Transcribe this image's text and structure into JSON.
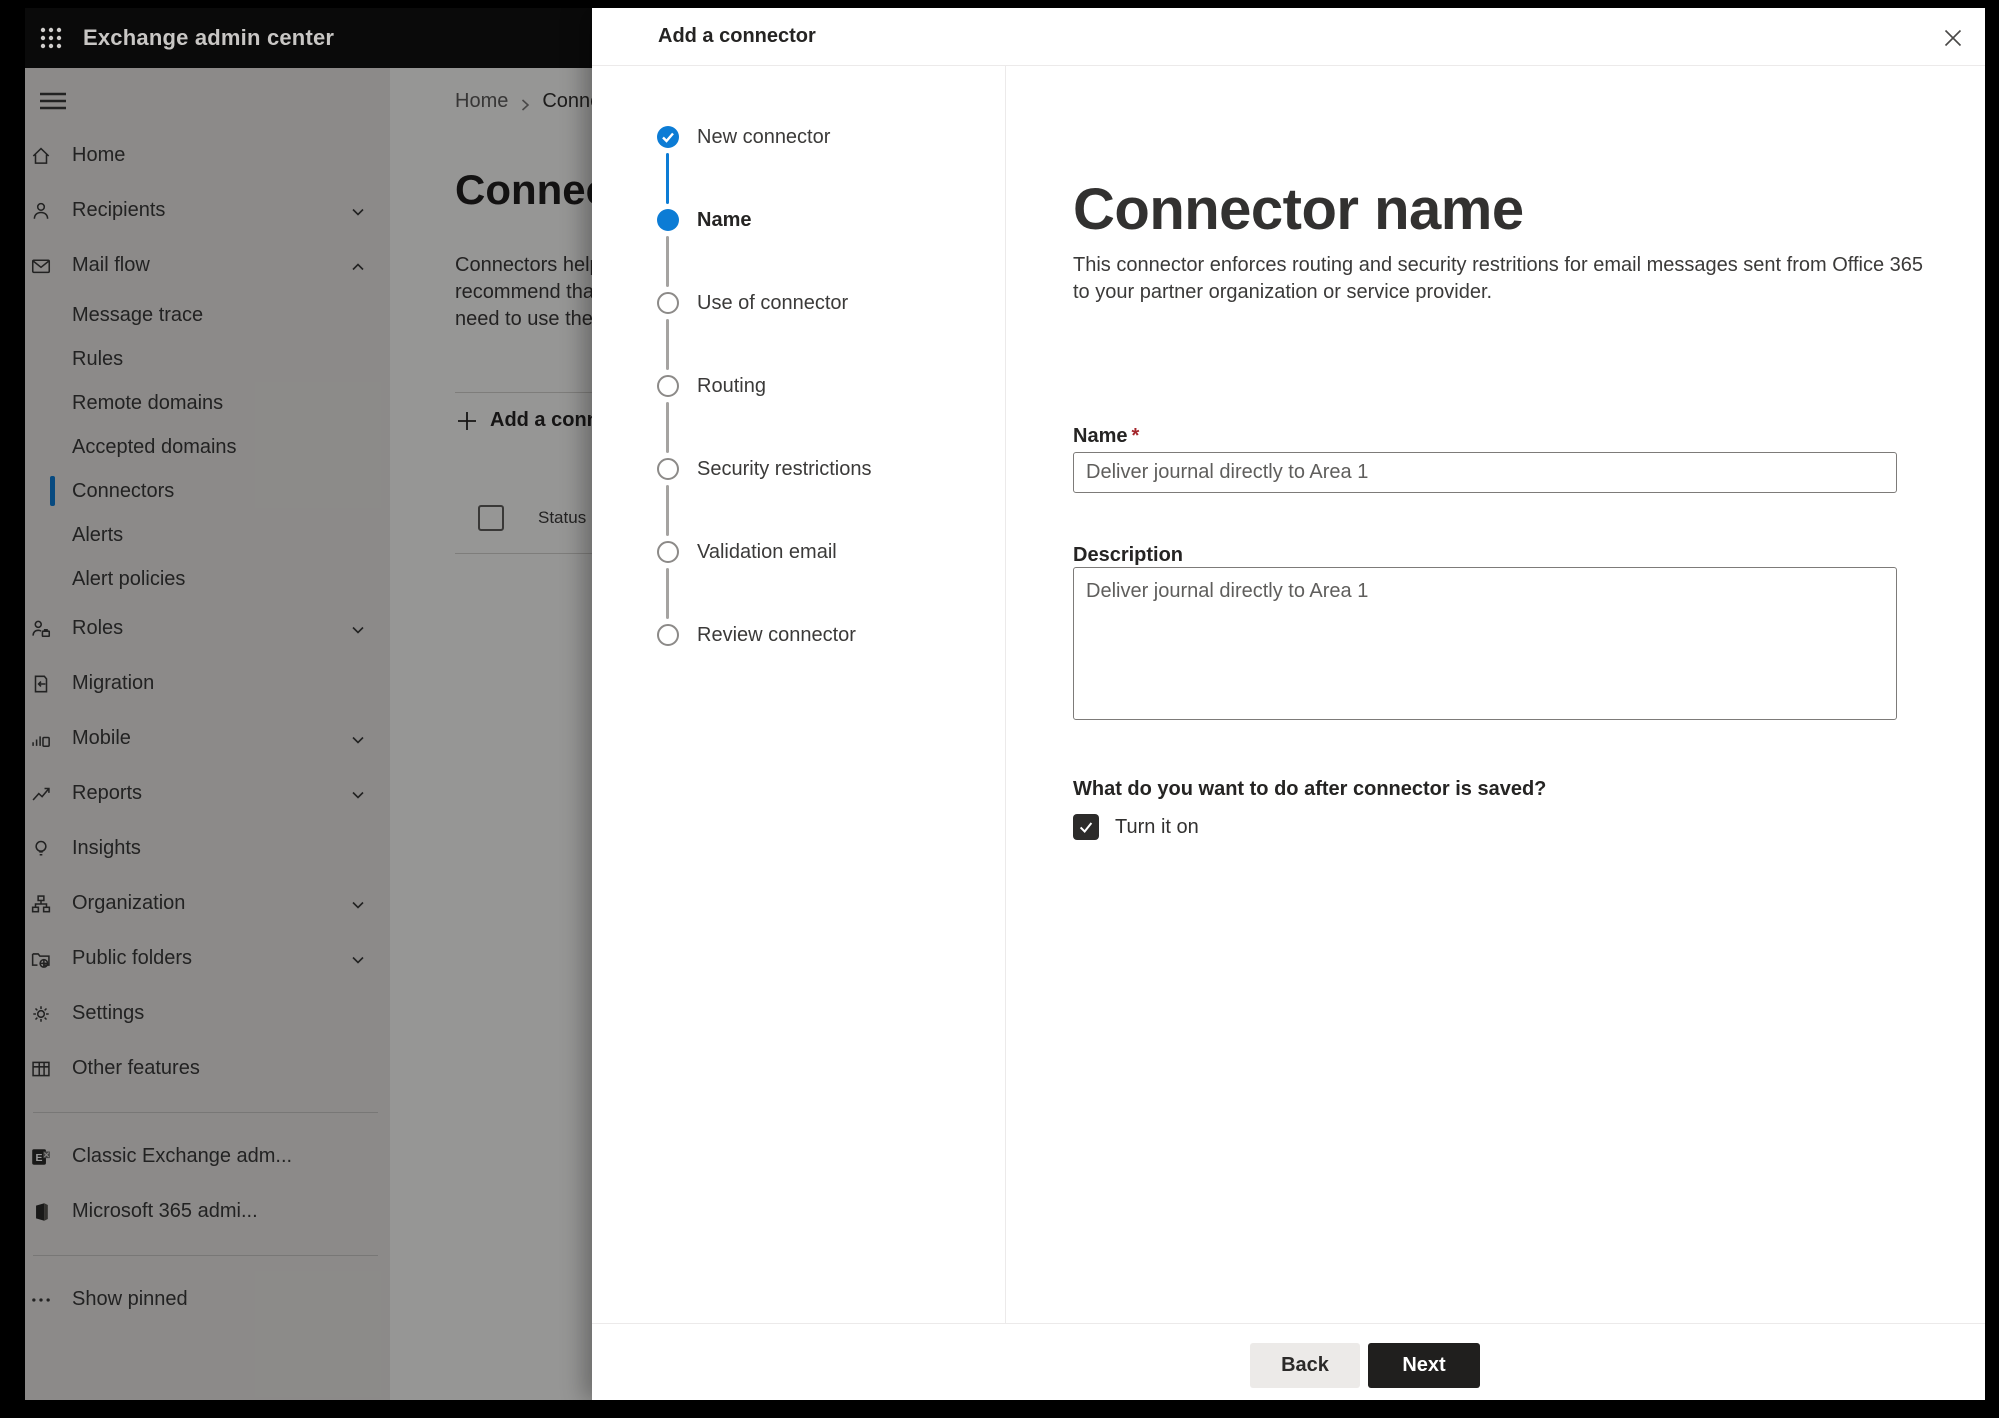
{
  "colors": {
    "accent": "#0c7cd5",
    "dark_button": "#201f1e",
    "required": "#a4262c"
  },
  "appbar": {
    "title": "Exchange admin center"
  },
  "sidebar": {
    "items": [
      {
        "label": "Home",
        "icon": "home"
      },
      {
        "label": "Recipients",
        "icon": "person",
        "chevron": "down"
      },
      {
        "label": "Mail flow",
        "icon": "mail",
        "chevron": "up"
      },
      {
        "label": "Message trace",
        "sub": true
      },
      {
        "label": "Rules",
        "sub": true
      },
      {
        "label": "Remote domains",
        "sub": true
      },
      {
        "label": "Accepted domains",
        "sub": true
      },
      {
        "label": "Connectors",
        "sub": true,
        "selected": true
      },
      {
        "label": "Alerts",
        "sub": true
      },
      {
        "label": "Alert policies",
        "sub": true
      },
      {
        "label": "Roles",
        "icon": "roles",
        "chevron": "down"
      },
      {
        "label": "Migration",
        "icon": "migration"
      },
      {
        "label": "Mobile",
        "icon": "mobile",
        "chevron": "down"
      },
      {
        "label": "Reports",
        "icon": "reports",
        "chevron": "down"
      },
      {
        "label": "Insights",
        "icon": "insights"
      },
      {
        "label": "Organization",
        "icon": "organization",
        "chevron": "down"
      },
      {
        "label": "Public folders",
        "icon": "folders",
        "chevron": "down"
      },
      {
        "label": "Settings",
        "icon": "settings"
      },
      {
        "label": "Other features",
        "icon": "grid"
      },
      {
        "divider": true
      },
      {
        "label": "Classic Exchange adm...",
        "icon": "exchange"
      },
      {
        "label": "Microsoft 365 admi...",
        "icon": "m365"
      },
      {
        "divider": true
      },
      {
        "label": "Show pinned",
        "icon": "ellipsis"
      }
    ]
  },
  "page": {
    "breadcrumb": {
      "home": "Home",
      "current": "Connectors"
    },
    "title": "Connectors",
    "intro_lines": [
      "Connectors help",
      "recommend that",
      "need to use ther"
    ],
    "add_button": "Add a connector",
    "table": {
      "status_header": "Status"
    }
  },
  "dialog": {
    "title": "Add a connector",
    "steps": [
      {
        "label": "New connector",
        "state": "done"
      },
      {
        "label": "Name",
        "state": "current"
      },
      {
        "label": "Use of connector",
        "state": "todo"
      },
      {
        "label": "Routing",
        "state": "todo"
      },
      {
        "label": "Security restrictions",
        "state": "todo"
      },
      {
        "label": "Validation email",
        "state": "todo"
      },
      {
        "label": "Review connector",
        "state": "todo"
      }
    ],
    "heading": "Connector name",
    "description_lines": [
      "This connector enforces routing and security restritions for email messages sent from Office 365",
      "to your partner organization or service provider."
    ],
    "name_field": {
      "label": "Name",
      "required_mark": "*",
      "value": "Deliver journal directly to Area 1"
    },
    "description_field": {
      "label": "Description",
      "value": "Deliver journal directly to Area 1"
    },
    "after_save": {
      "question": "What do you want to do after connector is saved?",
      "checkbox_label": "Turn it on",
      "checked": true
    },
    "footer": {
      "back": "Back",
      "next": "Next"
    }
  }
}
